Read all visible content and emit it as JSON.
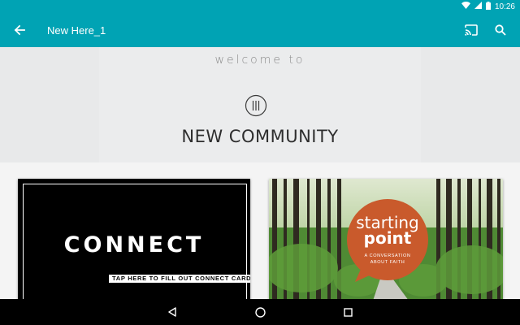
{
  "status_bar": {
    "time": "10:26"
  },
  "app_bar": {
    "title": "New Here_1",
    "icons": [
      "back-arrow-icon",
      "cast-icon",
      "search-icon"
    ]
  },
  "hero": {
    "welcome": "welcome to",
    "title": "NEW COMMUNITY"
  },
  "cards": [
    {
      "title": "CONNECT",
      "caption": "TAP HERE TO FILL OUT CONNECT CARD"
    },
    {
      "title_line1": "starting",
      "title_line2": "point",
      "subtitle_line1": "A CONVERSATION",
      "subtitle_line2": "ABOUT FAITH"
    }
  ],
  "nav_bar": {
    "icons": [
      "back-triangle-icon",
      "home-circle-icon",
      "recents-square-icon"
    ]
  },
  "colors": {
    "accent": "#00a3b4",
    "badge": "#c95a2c",
    "hero_bg": "#e8e9ea"
  }
}
